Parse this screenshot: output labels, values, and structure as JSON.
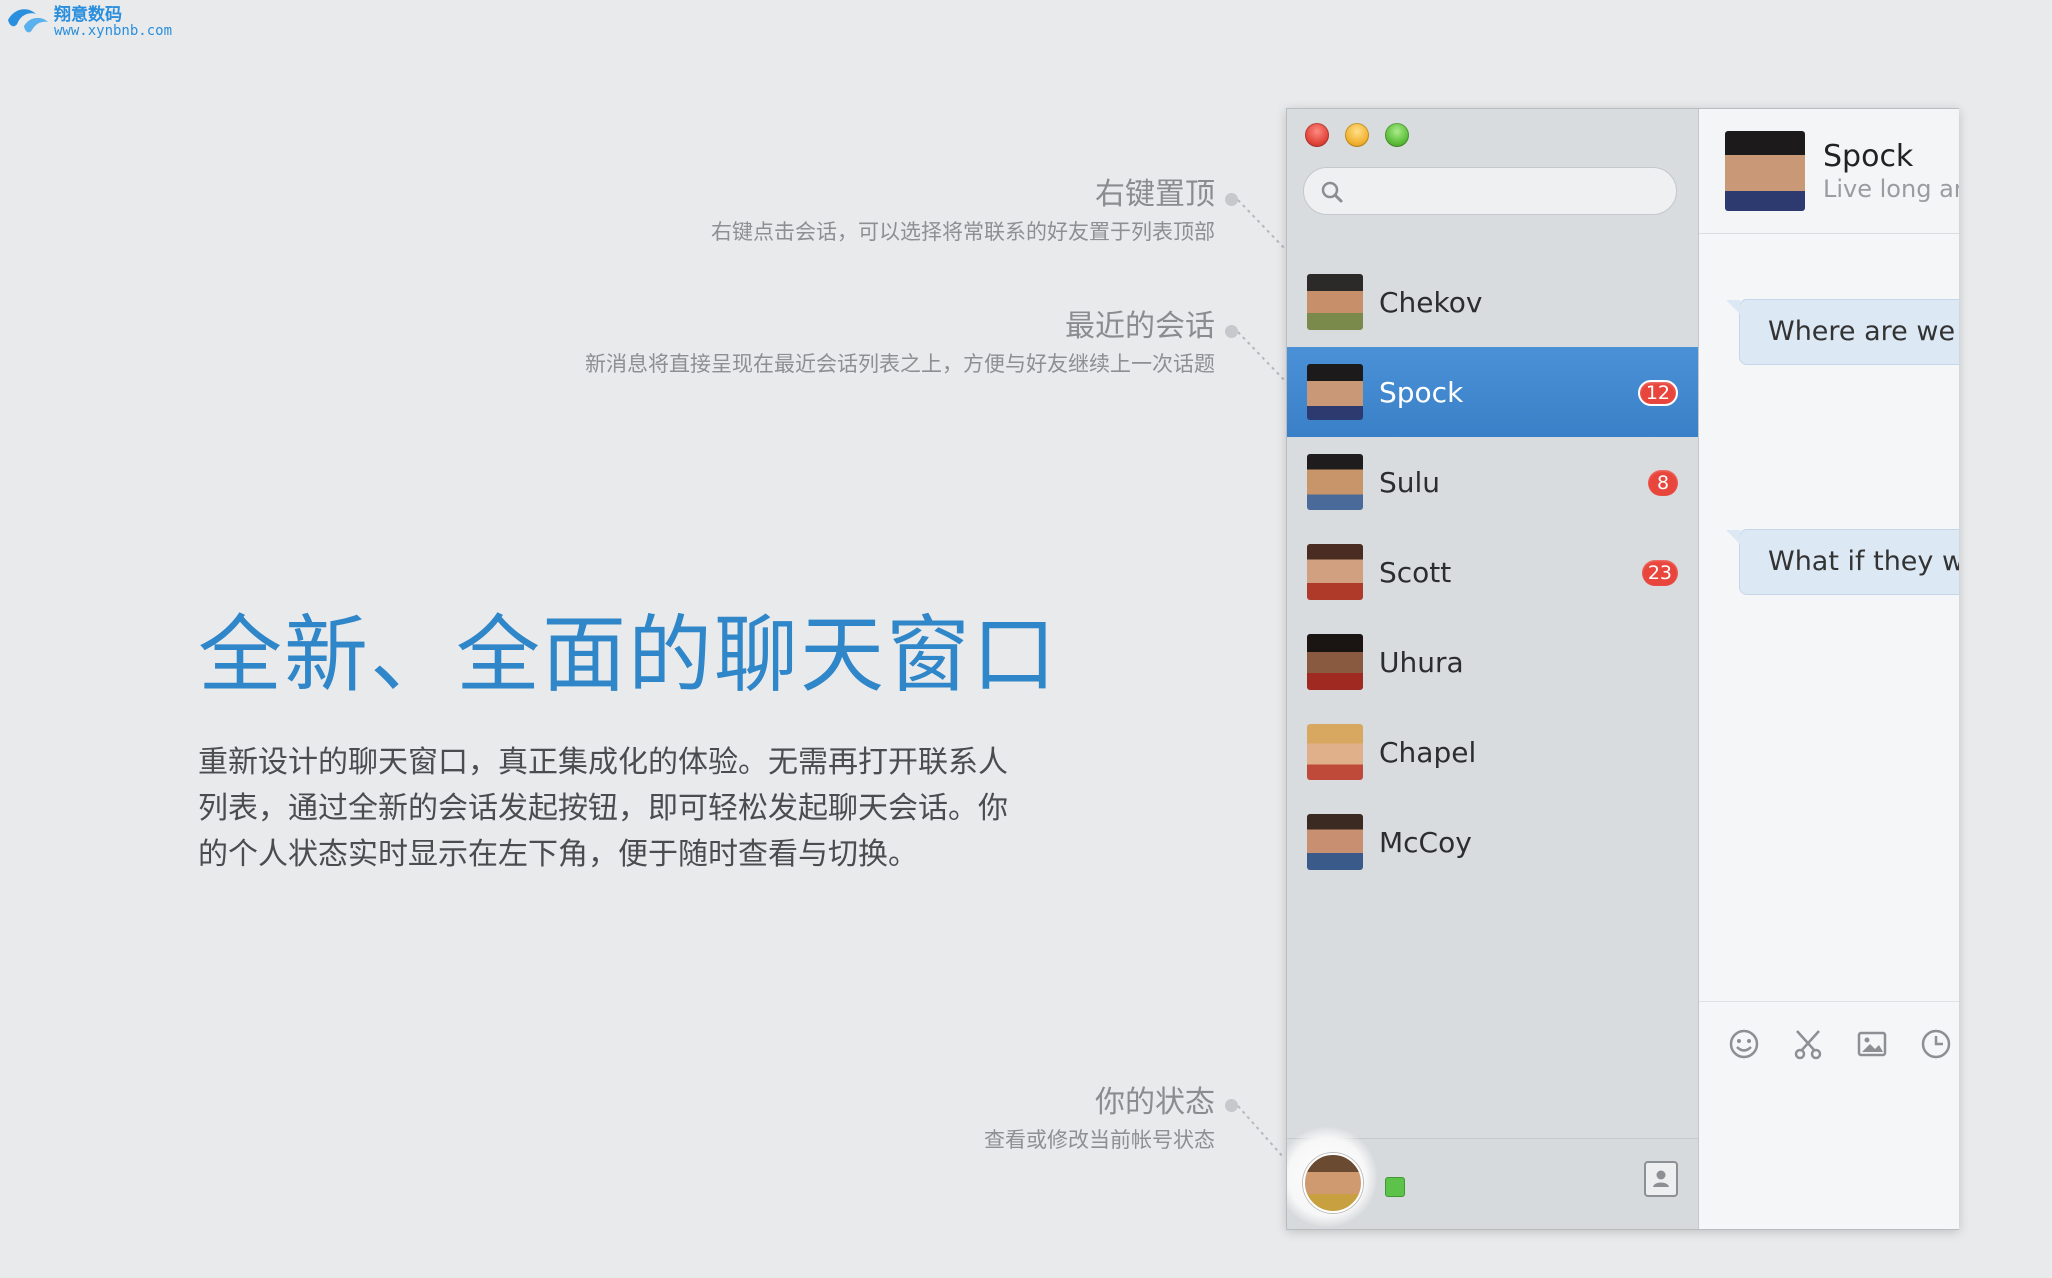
{
  "watermark": {
    "line1": "翔意数码",
    "line2": "www.xynbnb.com"
  },
  "annotations": [
    {
      "title": "右键置顶",
      "desc": "右键点击会话，可以选择将常联系的好友置于列表顶部"
    },
    {
      "title": "最近的会话",
      "desc": "新消息将直接呈现在最近会话列表之上，方便与好友继续上一次话题"
    },
    {
      "title": "你的状态",
      "desc": "查看或修改当前帐号状态"
    }
  ],
  "hero": {
    "title": "全新、全面的聊天窗口",
    "text": "重新设计的聊天窗口，真正集成化的体验。无需再打开联系人列表，通过全新的会话发起按钮，即可轻松发起聊天会话。你的个人状态实时显示在左下角，便于随时查看与切换。"
  },
  "search": {
    "placeholder": ""
  },
  "contacts": [
    {
      "name": "Chekov",
      "badge": "",
      "selected": false
    },
    {
      "name": "Spock",
      "badge": "12",
      "selected": true
    },
    {
      "name": "Sulu",
      "badge": "8",
      "selected": false
    },
    {
      "name": "Scott",
      "badge": "23",
      "selected": false
    },
    {
      "name": "Uhura",
      "badge": "",
      "selected": false
    },
    {
      "name": "Chapel",
      "badge": "",
      "selected": false
    },
    {
      "name": "McCoy",
      "badge": "",
      "selected": false
    }
  ],
  "chat": {
    "name": "Spock",
    "status": "Live long an",
    "messages": [
      "Where are we g",
      "What if they we"
    ]
  },
  "icons": {
    "search": "search-icon",
    "tools": [
      "emoji-icon",
      "scissors-icon",
      "image-icon",
      "clock-icon"
    ],
    "contacts_button": "contacts-icon"
  },
  "colors": {
    "accent": "#2f86c8",
    "selection": "#3f86cc",
    "badge": "#e8453c",
    "status_online": "#5cc24a"
  }
}
